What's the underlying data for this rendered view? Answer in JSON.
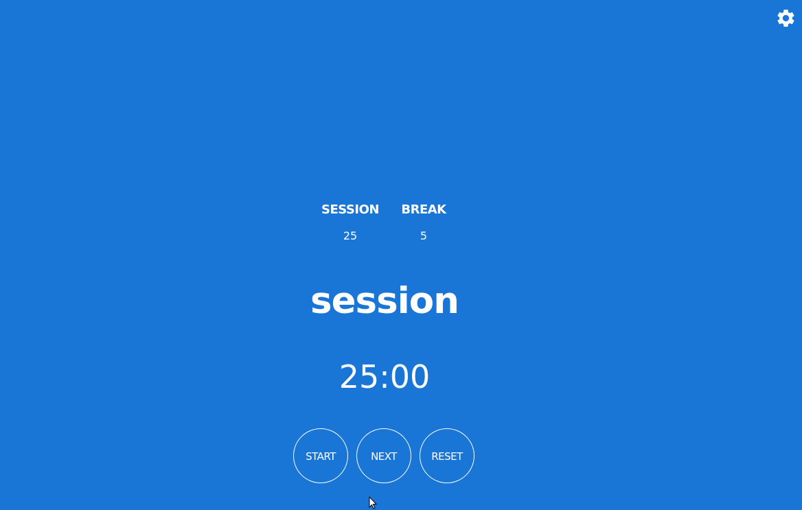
{
  "settings": {
    "icon": "gear-icon"
  },
  "durations": {
    "session": {
      "label": "SESSION",
      "value": "25"
    },
    "break": {
      "label": "BREAK",
      "value": "5"
    }
  },
  "mode": "session",
  "timer": "25:00",
  "buttons": {
    "start": "START",
    "next": "NEXT",
    "reset": "RESET"
  },
  "colors": {
    "background": "#1976d6",
    "foreground": "#ffffff"
  }
}
